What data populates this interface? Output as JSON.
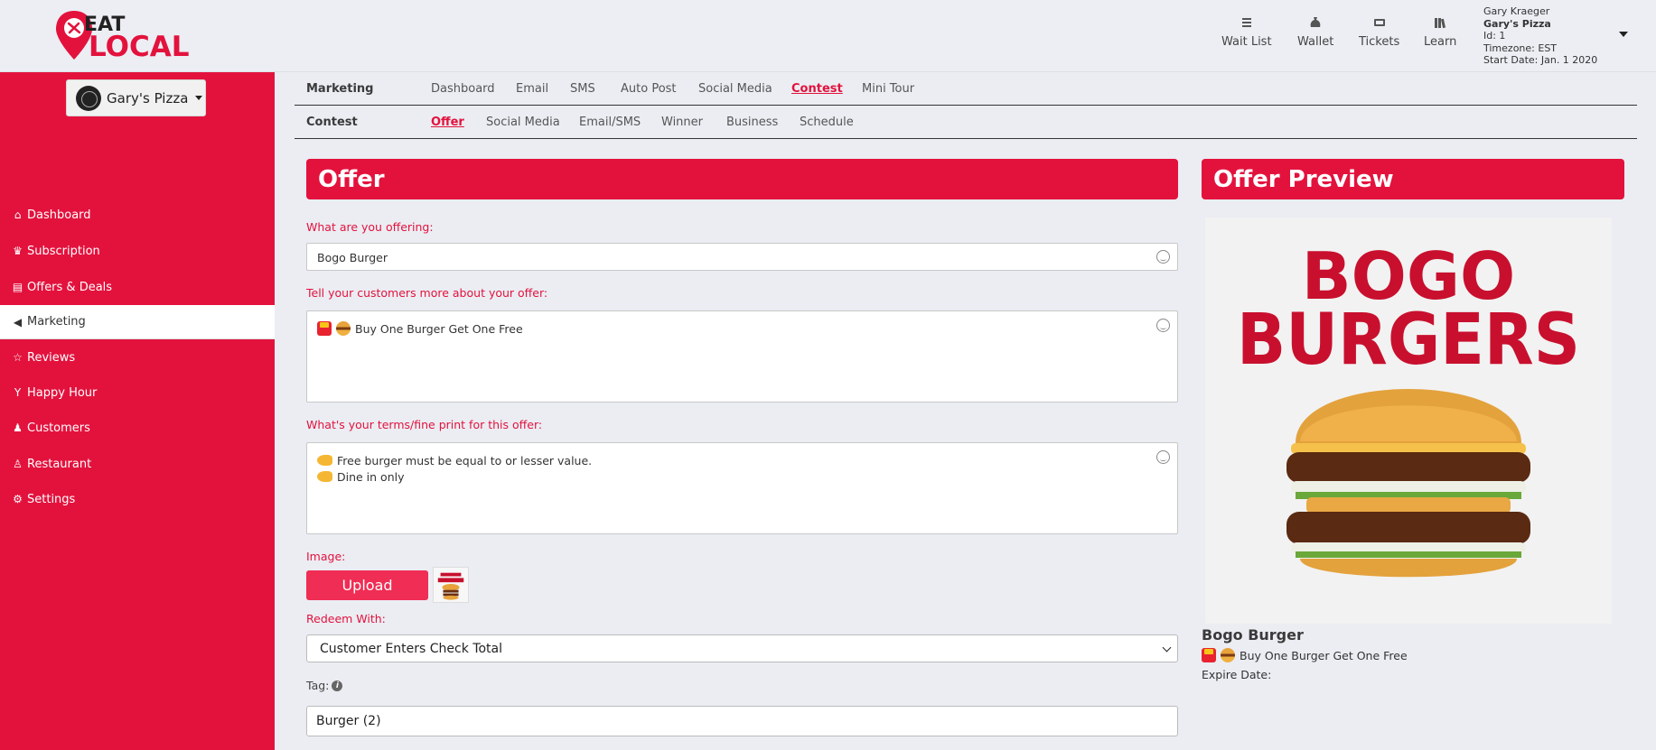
{
  "brand": {
    "line1": "EAT",
    "line2": "LOCAL",
    "color": "#e3123d"
  },
  "topnav": [
    {
      "label": "Wait List",
      "icon": "list-icon"
    },
    {
      "label": "Wallet",
      "icon": "money-bag-icon"
    },
    {
      "label": "Tickets",
      "icon": "ticket-icon"
    },
    {
      "label": "Learn",
      "icon": "books-icon"
    }
  ],
  "user": {
    "name": "Gary Kraeger",
    "restaurant": "Gary's Pizza",
    "id": "Id: 1",
    "timezone": "Timezone: EST",
    "start_date": "Start Date: Jan. 1 2020"
  },
  "sidebar": {
    "restaurant_select": "Gary's Pizza",
    "items": [
      {
        "label": "Dashboard",
        "icon": "home-icon"
      },
      {
        "label": "Subscription",
        "icon": "crown-icon"
      },
      {
        "label": "Offers & Deals",
        "icon": "document-icon"
      },
      {
        "label": "Marketing",
        "icon": "megaphone-icon",
        "active": true
      },
      {
        "label": "Reviews",
        "icon": "star-icon"
      },
      {
        "label": "Happy Hour",
        "icon": "cocktail-icon"
      },
      {
        "label": "Customers",
        "icon": "people-icon"
      },
      {
        "label": "Restaurant",
        "icon": "chef-icon"
      },
      {
        "label": "Settings",
        "icon": "gear-icon"
      }
    ]
  },
  "marketing_nav": {
    "title": "Marketing",
    "links": [
      "Dashboard",
      "Email",
      "SMS",
      "Auto Post",
      "Social Media",
      "Contest",
      "Mini Tour"
    ],
    "active": "Contest"
  },
  "contest_nav": {
    "title": "Contest",
    "links": [
      "Offer",
      "Social Media",
      "Email/SMS",
      "Winner",
      "Business",
      "Schedule"
    ],
    "active": "Offer"
  },
  "offer_form": {
    "header": "Offer",
    "offering_label": "What are you offering:",
    "offering_value": "Bogo Burger",
    "description_label": "Tell your customers more about your offer:",
    "description_value": "Buy One Burger Get One Free",
    "terms_label": "What's your terms/fine print for this offer:",
    "terms_lines": [
      "Free burger must be equal to or lesser value.",
      "Dine in only"
    ],
    "image_label": "Image:",
    "upload_label": "Upload",
    "redeem_label": "Redeem With:",
    "redeem_value": "Customer Enters Check Total",
    "tag_label": "Tag:",
    "tag_value": "Burger (2)"
  },
  "preview": {
    "header": "Offer Preview",
    "image_text_1": "BOGO",
    "image_text_2": "BURGERS",
    "title": "Bogo Burger",
    "description": "Buy One Burger Get One Free",
    "expire_label": "Expire Date:"
  }
}
